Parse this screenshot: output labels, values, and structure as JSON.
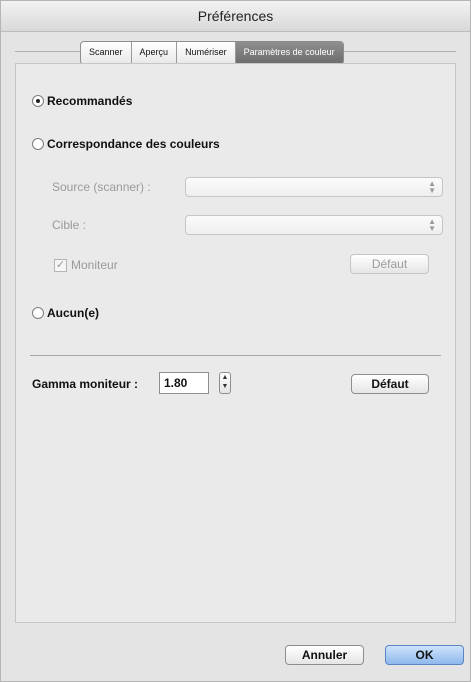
{
  "window": {
    "title": "Préférences"
  },
  "tabs": [
    {
      "label": "Scanner"
    },
    {
      "label": "Aperçu"
    },
    {
      "label": "Numériser"
    },
    {
      "label": "Paramètres de couleur"
    }
  ],
  "color": {
    "recommended_label": "Recommandés",
    "matching_label": "Correspondance des couleurs",
    "source_label": "Source (scanner) :",
    "source_value": "",
    "target_label": "Cible :",
    "target_value": "",
    "monitor_label": "Moniteur",
    "monitor_checked": true,
    "default_label": "Défaut",
    "none_label": "Aucun(e)",
    "selected": "Recommandés"
  },
  "gamma": {
    "label": "Gamma moniteur :",
    "value": "1.80",
    "default_label": "Défaut"
  },
  "footer": {
    "cancel_label": "Annuler",
    "ok_label": "OK"
  }
}
